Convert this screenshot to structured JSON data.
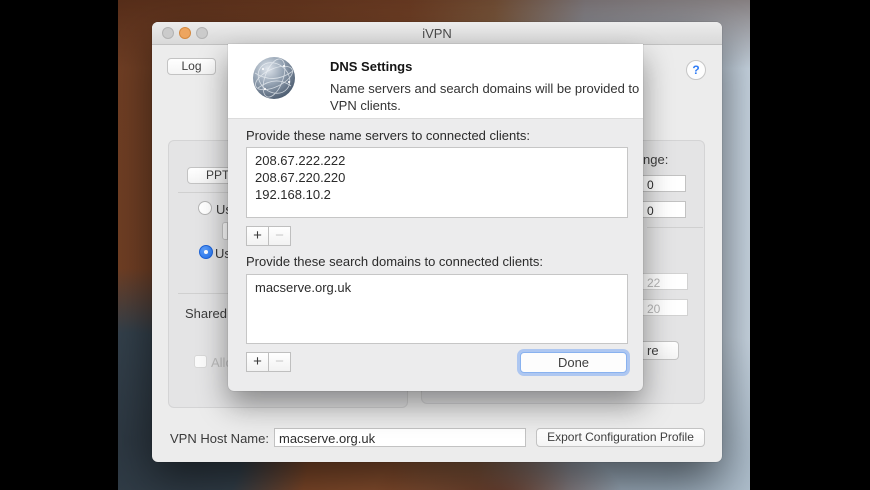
{
  "window": {
    "title": "iVPN",
    "log_button_label": "Log",
    "help_button_label": "?",
    "left_panel": {
      "protocol_fragment": "PPT",
      "radio1_label": "Us",
      "radio2_label": "Us",
      "shared_label": "Shared S",
      "allow_label": "Allo"
    },
    "right_panel": {
      "range_label_fragment": "nge:",
      "field1_value": "0",
      "field2_value": "0",
      "disabled_field1_value": "22",
      "disabled_field2_value": "20",
      "button_fragment": "re"
    },
    "bottom_bar": {
      "host_label": "VPN Host Name:",
      "host_value": "macserve.org.uk",
      "export_button_label": "Export Configuration Profile"
    }
  },
  "sheet": {
    "title": "DNS Settings",
    "description_line1": "Name servers and search domains will be provided to",
    "description_line2": "VPN clients.",
    "name_servers_label": "Provide these name servers to connected clients:",
    "name_servers": [
      "208.67.222.222",
      "208.67.220.220",
      "192.168.10.2"
    ],
    "search_domains_label": "Provide these search domains to connected clients:",
    "search_domains": [
      "macserve.org.uk"
    ],
    "add_label": "+",
    "remove_label": "−",
    "done_label": "Done"
  },
  "colors": {
    "accent_blue": "#2f7cf6",
    "focus_ring": "#7da9f4",
    "minimize_orange": "#eda55f",
    "radio_selected": "#2171ee"
  }
}
